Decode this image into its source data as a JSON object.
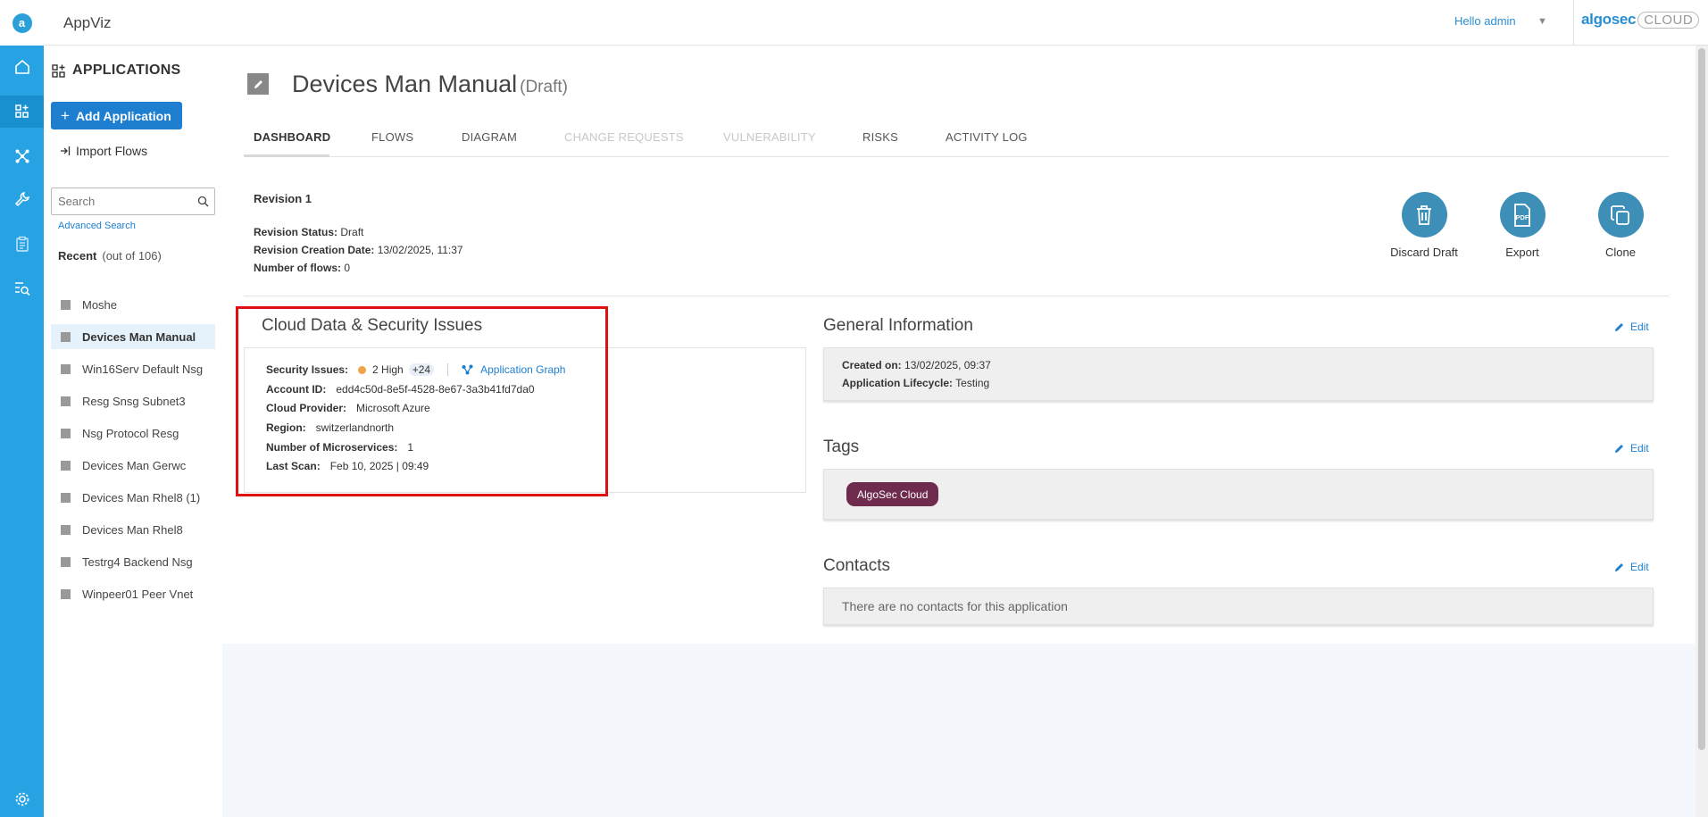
{
  "topbar": {
    "app_title": "AppViz",
    "greeting": "Hello admin",
    "brand": "algosec",
    "brand_suffix": "CLOUD"
  },
  "sidebar": {
    "heading": "APPLICATIONS",
    "add_button": "Add Application",
    "import_flows": "Import Flows",
    "search_placeholder": "Search",
    "advanced_search": "Advanced Search",
    "recent_label": "Recent",
    "recent_count": "(out of 106)",
    "items": [
      {
        "label": "Moshe",
        "active": false
      },
      {
        "label": "Devices Man Manual",
        "active": true
      },
      {
        "label": "Win16Serv Default Nsg",
        "active": false
      },
      {
        "label": "Resg Snsg Subnet3",
        "active": false
      },
      {
        "label": "Nsg Protocol Resg",
        "active": false
      },
      {
        "label": "Devices Man Gerwc",
        "active": false
      },
      {
        "label": "Devices Man Rhel8 (1)",
        "active": false
      },
      {
        "label": "Devices Man Rhel8",
        "active": false
      },
      {
        "label": "Testrg4 Backend Nsg",
        "active": false
      },
      {
        "label": "Winpeer01 Peer Vnet",
        "active": false
      }
    ]
  },
  "page": {
    "title": "Devices Man Manual",
    "status_suffix": "(Draft)"
  },
  "tabs": [
    {
      "label": "DASHBOARD",
      "state": "active"
    },
    {
      "label": "FLOWS",
      "state": "normal"
    },
    {
      "label": "DIAGRAM",
      "state": "normal"
    },
    {
      "label": "CHANGE REQUESTS",
      "state": "disabled"
    },
    {
      "label": "VULNERABILITY",
      "state": "disabled"
    },
    {
      "label": "RISKS",
      "state": "normal"
    },
    {
      "label": "ACTIVITY LOG",
      "state": "normal"
    }
  ],
  "revision": {
    "title": "Revision 1",
    "status_label": "Revision Status:",
    "status_value": "Draft",
    "created_label": "Revision Creation Date:",
    "created_value": "13/02/2025, 11:37",
    "flows_label": "Number of flows:",
    "flows_value": "0"
  },
  "actions": {
    "discard": "Discard Draft",
    "export": "Export",
    "clone": "Clone"
  },
  "cloud": {
    "title": "Cloud Data & Security Issues",
    "security_label": "Security Issues:",
    "security_high": "2 High",
    "security_more": "+24",
    "graph_link": "Application Graph",
    "account_label": "Account ID:",
    "account_value": "edd4c50d-8e5f-4528-8e67-3a3b41fd7da0",
    "provider_label": "Cloud Provider:",
    "provider_value": "Microsoft Azure",
    "region_label": "Region:",
    "region_value": "switzerlandnorth",
    "micro_label": "Number of Microservices:",
    "micro_value": "1",
    "scan_label": "Last Scan:",
    "scan_value": "Feb 10, 2025 | 09:49",
    "issue_color": "#f0a448"
  },
  "general": {
    "title": "General Information",
    "edit": "Edit",
    "created_label": "Created on:",
    "created_value": "13/02/2025, 09:37",
    "lifecycle_label": "Application Lifecycle:",
    "lifecycle_value": "Testing"
  },
  "tags": {
    "title": "Tags",
    "edit": "Edit",
    "items": [
      "AlgoSec Cloud"
    ],
    "tag_color": "#6e2b4e"
  },
  "contacts": {
    "title": "Contacts",
    "edit": "Edit",
    "empty": "There are no contacts for this application"
  },
  "colors": {
    "rail": "#27a3e3",
    "primary": "#1e7fd0",
    "action": "#3d8fb8",
    "highlight": "#e01010"
  }
}
